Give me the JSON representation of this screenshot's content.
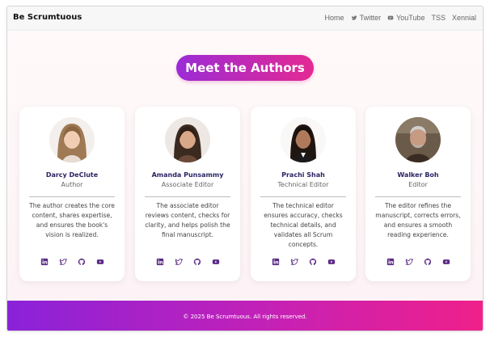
{
  "nav": {
    "brand": "Be Scrumtuous",
    "links": [
      {
        "label": "Home",
        "icon": ""
      },
      {
        "label": "Twitter",
        "icon": "twitter-icon"
      },
      {
        "label": "YouTube",
        "icon": "youtube-icon"
      },
      {
        "label": "TSS",
        "icon": ""
      },
      {
        "label": "Xennial",
        "icon": ""
      }
    ]
  },
  "hero": {
    "title": "Meet the Authors"
  },
  "authors": [
    {
      "name": "Darcy DeClute",
      "role": "Author",
      "description": "The author creates the core content, shares expertise, and ensures the book's vision is realized."
    },
    {
      "name": "Amanda Punsammy",
      "role": "Associate Editor",
      "description": "The associate editor reviews content, checks for clarity, and helps polish the final manuscript."
    },
    {
      "name": "Prachi Shah",
      "role": "Technical Editor",
      "description": "The technical editor ensures accuracy, checks technical details, and validates all Scrum concepts."
    },
    {
      "name": "Walker Boh",
      "role": "Editor",
      "description": "The editor refines the manuscript, corrects errors, and ensures a smooth reading experience."
    }
  ],
  "social_icons": [
    "linkedin-icon",
    "twitter-icon",
    "github-icon",
    "youtube-icon"
  ],
  "footer": {
    "text": "© 2025 Be Scrumtuous. All rights reserved."
  },
  "colors": {
    "accent_purple": "#9b2bd6",
    "accent_pink": "#e42a92",
    "name_color": "#2a2464",
    "icon_color": "#5b2a86"
  }
}
